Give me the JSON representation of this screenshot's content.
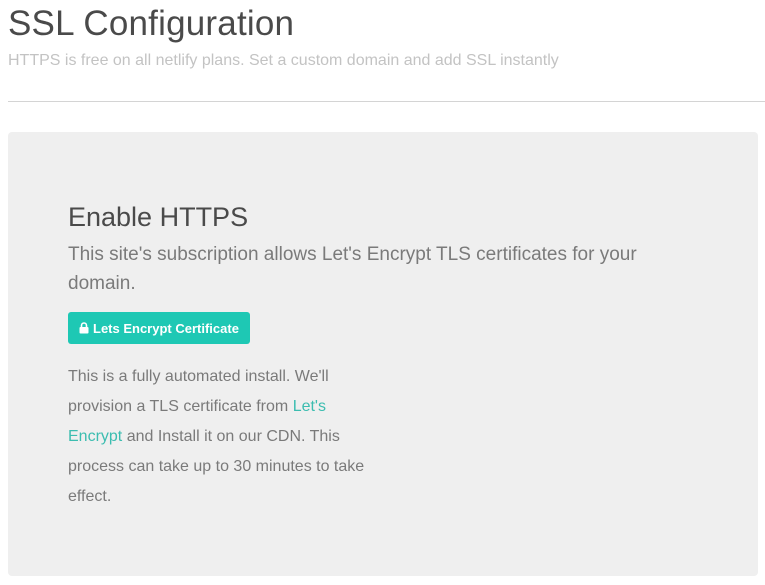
{
  "header": {
    "title": "SSL Configuration",
    "subtitle": "HTTPS is free on all netlify plans. Set a custom domain and add SSL instantly"
  },
  "card": {
    "title": "Enable HTTPS",
    "lead": "This site's subscription allows Let's Encrypt TLS certificates for your domain.",
    "button": {
      "label": "Lets Encrypt Certificate",
      "icon": "lock-icon"
    },
    "body": {
      "text_before_link": "This is a fully automated install. We'll provision a TLS certificate from ",
      "link_text": "Let's Encrypt",
      "text_after_link": " and Install it on our CDN. This process can take up to 30 minutes to take effect."
    }
  },
  "colors": {
    "accent": "#1ec8b4",
    "link": "#3cbdb0",
    "card_background": "#efefef",
    "title_text": "#4a4a4a",
    "muted_text": "#7a7a7a",
    "subtitle_text": "#c3c3c3"
  }
}
